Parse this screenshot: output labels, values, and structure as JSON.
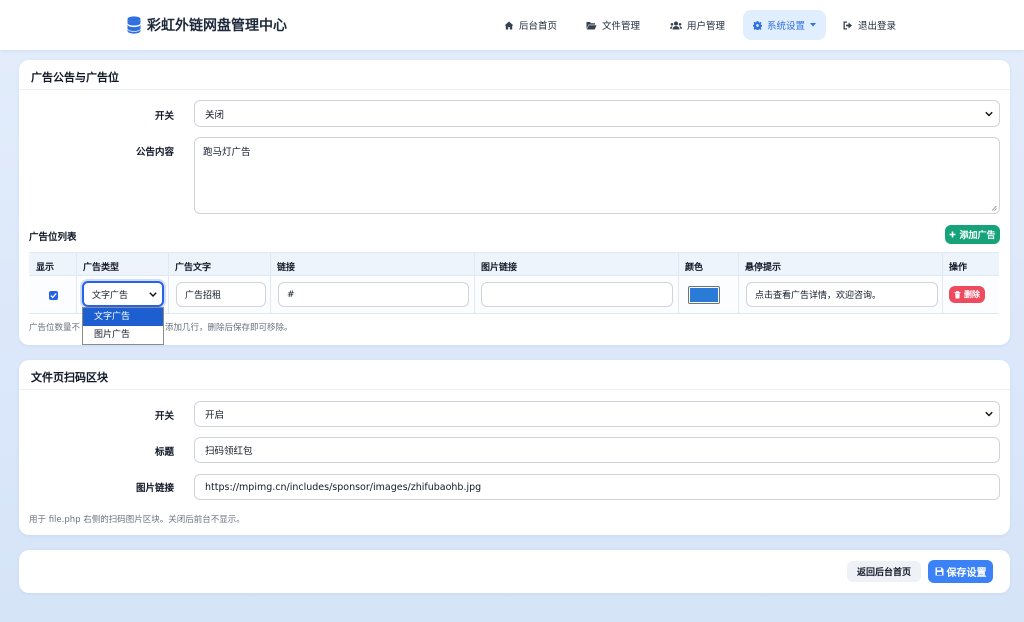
{
  "brand": {
    "title": "彩虹外链网盘管理中心",
    "icon": "database-icon"
  },
  "nav": {
    "home": "后台首页",
    "files": "文件管理",
    "users": "用户管理",
    "settings": "系统设置",
    "logout": "退出登录"
  },
  "ad_section": {
    "title": "广告公告与广告位",
    "switch_label": "开关",
    "switch_value": "关闭",
    "notice_label": "公告内容",
    "notice_value": "跑马灯广告",
    "list_label": "广告位列表",
    "add_button": "添加广告",
    "columns": [
      "显示",
      "广告类型",
      "广告文字",
      "链接",
      "图片链接",
      "颜色",
      "悬停提示",
      "操作"
    ],
    "rows": [
      {
        "shown": true,
        "type": "文字广告",
        "text": "广告招租",
        "link": "#",
        "image_link": "",
        "color": "#2a7bd5",
        "tooltip": "点击查看广告详情，欢迎咨询。",
        "delete_label": "删除"
      }
    ],
    "type_options": [
      "文字广告",
      "图片广告"
    ],
    "hint_left": "广告位数量不",
    "hint_right": "添加几行，删除后保存即可移除。"
  },
  "qr_section": {
    "title": "文件页扫码区块",
    "switch_label": "开关",
    "switch_value": "开启",
    "title_label": "标题",
    "title_value": "扫码领红包",
    "image_label": "图片链接",
    "image_value": "https://mpimg.cn/includes/sponsor/images/zhifubaohb.jpg",
    "hint": "用于 file.php 右侧的扫码图片区块。关闭后前台不显示。"
  },
  "footer": {
    "back_button": "返回后台首页",
    "save_button": "保存设置"
  },
  "colors": {
    "accent": "#3b82f6",
    "green": "#16a37a",
    "danger": "#ef4b5f"
  }
}
